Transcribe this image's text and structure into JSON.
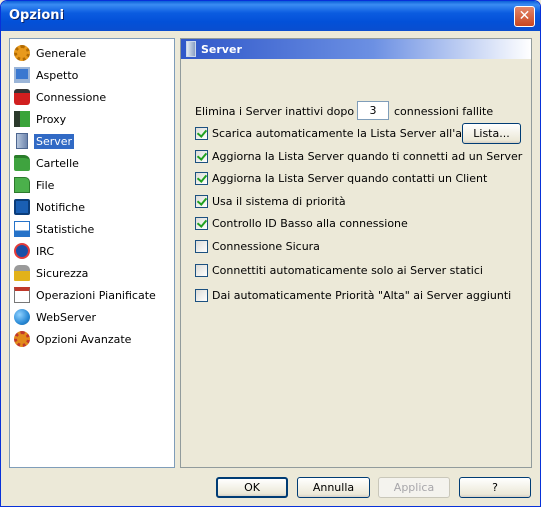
{
  "window": {
    "title": "Opzioni",
    "close_symbol": "✕"
  },
  "sidebar": {
    "items": [
      {
        "label": "Generale",
        "icon": "gear-icon",
        "color": "#e89a1c"
      },
      {
        "label": "Aspetto",
        "icon": "monitor-icon",
        "color": "#3a78d0"
      },
      {
        "label": "Connessione",
        "icon": "plug-icon",
        "color": "#d11f1f"
      },
      {
        "label": "Proxy",
        "icon": "proxy-icon",
        "color": "#3aa43a"
      },
      {
        "label": "Server",
        "icon": "server-icon",
        "color": "#7b93b8",
        "selected": true
      },
      {
        "label": "Cartelle",
        "icon": "folder-icon",
        "color": "#3fa33f"
      },
      {
        "label": "File",
        "icon": "file-icon",
        "color": "#4bb04b"
      },
      {
        "label": "Notifiche",
        "icon": "notification-icon",
        "color": "#1a5fb4"
      },
      {
        "label": "Statistiche",
        "icon": "chart-icon",
        "color": "#2673c9"
      },
      {
        "label": "IRC",
        "icon": "irc-icon",
        "color": "#1a4fa8"
      },
      {
        "label": "Sicurezza",
        "icon": "lock-icon",
        "color": "#e2b21a"
      },
      {
        "label": "Operazioni Pianificate",
        "icon": "calendar-icon",
        "color": "#c0392b"
      },
      {
        "label": "WebServer",
        "icon": "globe-icon",
        "color": "#2a8ad6"
      },
      {
        "label": "Opzioni Avanzate",
        "icon": "advanced-gear-icon",
        "color": "#e28a1c"
      }
    ]
  },
  "panel": {
    "header": "Server",
    "remove_inactive": {
      "prefix": "Elimina i Server inattivi dopo",
      "value": "3",
      "suffix": "connessioni fallite"
    },
    "list_button": "Lista...",
    "options": [
      {
        "label": "Scarica automaticamente la Lista Server all'avvio",
        "checked": true
      },
      {
        "label": "Aggiorna la Lista Server quando ti connetti ad un Server",
        "checked": true
      },
      {
        "label": "Aggiorna la Lista Server quando contatti un Client",
        "checked": true
      },
      {
        "label": "Usa il sistema di priorità",
        "checked": true
      },
      {
        "label": "Controllo ID Basso alla connessione",
        "checked": true
      },
      {
        "label": "Connessione Sicura",
        "checked": false
      },
      {
        "label": "Connettiti automaticamente solo ai Server statici",
        "checked": false
      },
      {
        "label": "Dai automaticamente Priorità \"Alta\" ai Server aggiunti",
        "checked": false
      }
    ]
  },
  "footer": {
    "ok": "OK",
    "cancel": "Annulla",
    "apply": "Applica",
    "help": "?"
  }
}
